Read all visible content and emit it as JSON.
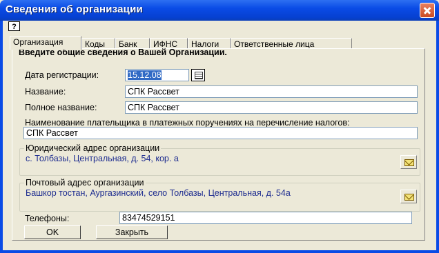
{
  "window": {
    "title": "Сведения об организации"
  },
  "help_button_label": "?",
  "tabs": [
    {
      "label": "Организация",
      "active": true
    },
    {
      "label": "Коды"
    },
    {
      "label": "Банк"
    },
    {
      "label": "ИФНС"
    },
    {
      "label": "Налоги"
    },
    {
      "label": "Ответственные лица"
    }
  ],
  "intro_text": "Введите общие сведения о Вашей Организации.",
  "fields": {
    "reg_date": {
      "label": "Дата регистрации:",
      "value": "15.12.08"
    },
    "name": {
      "label": "Название:",
      "value": "СПК Рассвет"
    },
    "full_name": {
      "label": "Полное название:",
      "value": "СПК Рассвет"
    },
    "payer_name": {
      "label": "Наименование плательщика в платежных поручениях на перечисление налогов:",
      "value": "СПК Рассвет"
    },
    "phones": {
      "label": "Телефоны:",
      "value": "83474529151"
    }
  },
  "legal_address": {
    "title": "Юридический адрес организации",
    "value": "с. Толбазы, Центральная, д. 54, кор. а"
  },
  "postal_address": {
    "title": "Почтовый адрес организации",
    "value": "Башкор тостан, Аургазинский, село Толбазы, Центральная, д. 54а"
  },
  "buttons": {
    "ok": "OK",
    "close": "Закрыть"
  }
}
